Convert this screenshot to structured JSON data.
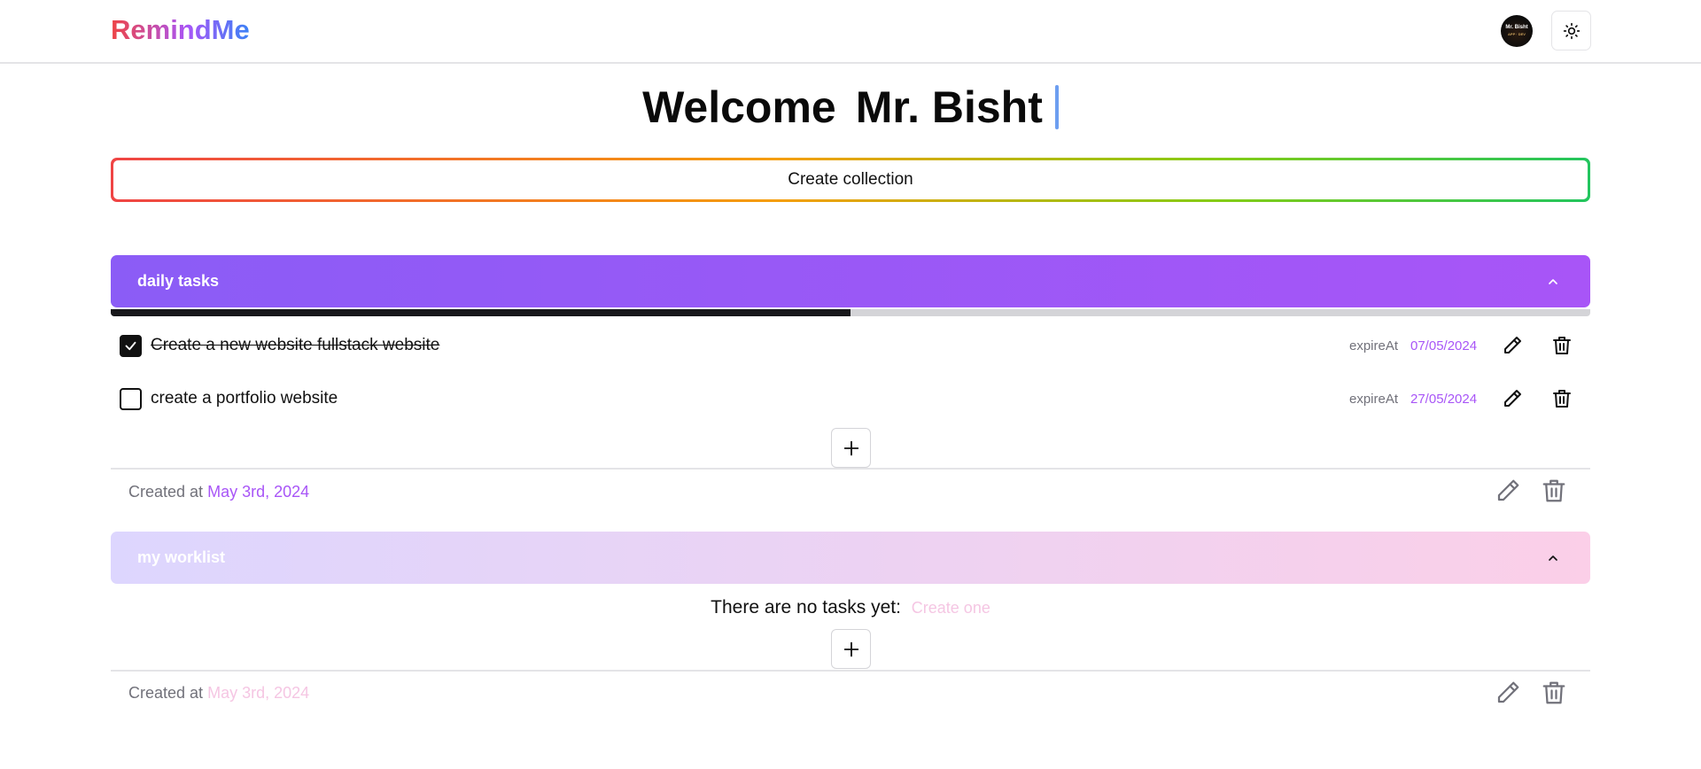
{
  "app": {
    "logo": "RemindMe",
    "avatar_text": "Mr. Bisht",
    "avatar_sub": "APP · DEV"
  },
  "welcome": {
    "greeting": "Welcome",
    "name": "Mr. Bisht"
  },
  "create_collection_label": "Create collection",
  "collections": [
    {
      "title": "daily tasks",
      "progress_percent": 50,
      "colors": {
        "from": "#8b5cf6",
        "to": "#a855f7"
      },
      "tasks": [
        {
          "label": "Create a new website fullstack website",
          "done": true,
          "expire_label": "expireAt",
          "date": "07/05/2024"
        },
        {
          "label": "create a portfolio website",
          "done": false,
          "expire_label": "expireAt",
          "date": "27/05/2024"
        }
      ],
      "created_label": "Created at",
      "created_date": "May 3rd, 2024"
    },
    {
      "title": "my worklist",
      "colors": {
        "from": "#ddd6fe",
        "to": "#fbcfe8"
      },
      "empty_text": "There are no tasks yet:",
      "empty_link": "Create one",
      "created_label": "Created at",
      "created_date": "May 3rd, 2024"
    }
  ],
  "icons": [
    "sun-icon",
    "chevron-up-icon",
    "check-icon",
    "pencil-icon",
    "trash-icon",
    "plus-icon"
  ]
}
